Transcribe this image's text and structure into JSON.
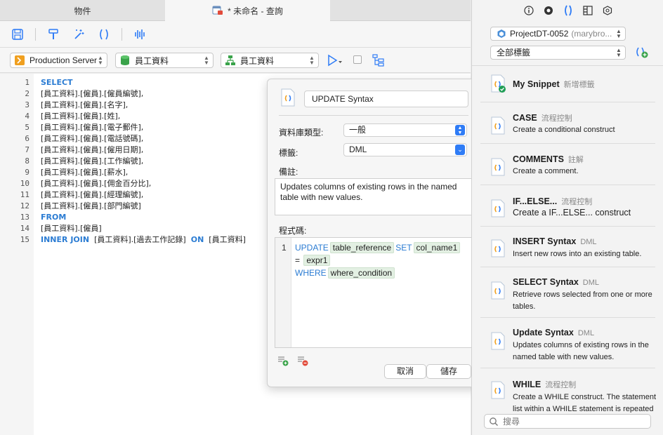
{
  "tabs": {
    "objects_label": "物件",
    "query_label": "* 未命名 - 查詢"
  },
  "connection": {
    "server": "Production Server",
    "database": "員工資料",
    "schema": "員工資料"
  },
  "editor": {
    "lines": [
      {
        "n": "1",
        "kw": "SELECT",
        "text": ""
      },
      {
        "n": "2",
        "kw": "",
        "text": "[員工資料].[僱員].[僱員編號],"
      },
      {
        "n": "3",
        "kw": "",
        "text": "[員工資料].[僱員].[名字],"
      },
      {
        "n": "4",
        "kw": "",
        "text": "[員工資料].[僱員].[姓],"
      },
      {
        "n": "5",
        "kw": "",
        "text": "[員工資料].[僱員].[電子郵件],"
      },
      {
        "n": "6",
        "kw": "",
        "text": "[員工資料].[僱員].[電話號碼],"
      },
      {
        "n": "7",
        "kw": "",
        "text": "[員工資料].[僱員].[僱用日期],"
      },
      {
        "n": "8",
        "kw": "",
        "text": "[員工資料].[僱員].[工作編號],"
      },
      {
        "n": "9",
        "kw": "",
        "text": "[員工資料].[僱員].[薪水],"
      },
      {
        "n": "10",
        "kw": "",
        "text": "[員工資料].[僱員].[佣金百分比],"
      },
      {
        "n": "11",
        "kw": "",
        "text": "[員工資料].[僱員].[經理編號],"
      },
      {
        "n": "12",
        "kw": "",
        "text": "[員工資料].[僱員].[部門編號]"
      },
      {
        "n": "13",
        "kw": "FROM",
        "text": ""
      },
      {
        "n": "14",
        "kw": "",
        "text": "[員工資料].[僱員]"
      }
    ],
    "line15": {
      "n": "15",
      "kw1": "INNER JOIN",
      "t1": "[員工資料].[過去工作記錄]",
      "kw2": "ON",
      "t2": "[員工資料]"
    }
  },
  "snippet_editor": {
    "name": "UPDATE Syntax",
    "db_type_label": "資料庫類型:",
    "db_type_value": "一般",
    "tag_label": "標籤:",
    "tag_value": "DML",
    "notes_label": "備註:",
    "notes": "Updates columns of existing rows in the named table with new values.",
    "code_label": "程式碼:",
    "code_line_number": "1",
    "code": {
      "kw_update": "UPDATE",
      "ph_table": "table_reference",
      "kw_set": "SET",
      "ph_col": "col_name1",
      "eq": "=",
      "ph_expr": "expr1",
      "kw_where": "WHERE",
      "ph_where": "where_condition"
    },
    "cancel_label": "取消",
    "save_label": "儲存"
  },
  "right_panel": {
    "project": "ProjectDT-0052",
    "project_owner": "(marybro...",
    "tags_filter": "全部標籤",
    "search_placeholder": "搜尋",
    "snippets": [
      {
        "title": "My Snippet",
        "tag": "新增標籤",
        "desc": ""
      },
      {
        "title": "CASE",
        "tag": "流程控制",
        "desc": "Create a conditional construct"
      },
      {
        "title": "COMMENTS",
        "tag": "註解",
        "desc": "Create a comment."
      },
      {
        "title": "IF...ELSE...",
        "tag": "流程控制",
        "desc": "Create a IF...ELSE... construct"
      },
      {
        "title": "INSERT Syntax",
        "tag": "DML",
        "desc": "Insert new rows into an existing table."
      },
      {
        "title": "SELECT Syntax",
        "tag": "DML",
        "desc": "Retrieve rows selected from one or more tables."
      },
      {
        "title": "Update Syntax",
        "tag": "DML",
        "desc": "Updates columns of existing rows in the named table with new values."
      },
      {
        "title": "WHILE",
        "tag": "流程控制",
        "desc": "Create a WHILE construct. The statement list within a WHILE statement is repeated"
      }
    ]
  },
  "colors": {
    "keyword": "#2b7cd3",
    "accent": "#2f7cf6",
    "snippet_icon": "#f0a020",
    "placeholder_bg": "#e3f0e3"
  }
}
